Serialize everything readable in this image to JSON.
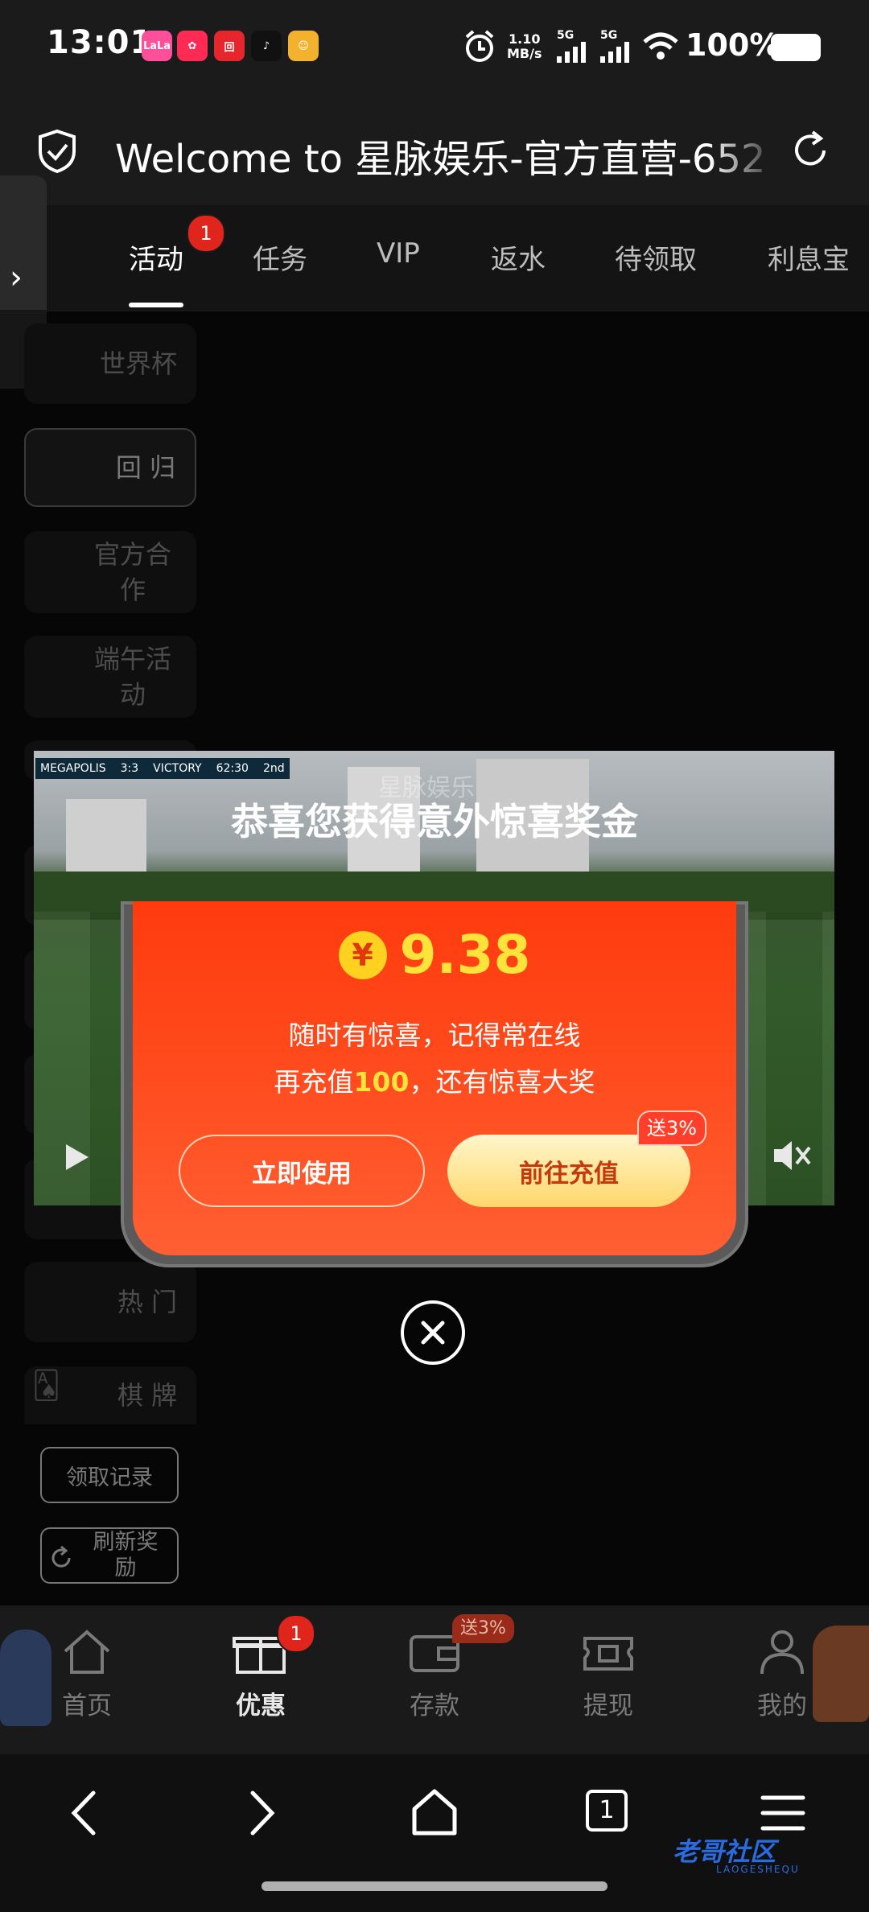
{
  "status_bar": {
    "time": "13:01",
    "app_icons": [
      {
        "name": "lala-app-icon",
        "label": "LaLa",
        "color": "#ff4f9a"
      },
      {
        "name": "xiaohongshu-app-icon",
        "label": "",
        "color": "#ff2b55"
      },
      {
        "name": "bank-app-icon",
        "label": "",
        "color": "#e5262c"
      },
      {
        "name": "tiktok-app-icon",
        "label": "",
        "color": "#111111"
      },
      {
        "name": "uc-app-icon",
        "label": "",
        "color": "#f3b22e"
      }
    ],
    "net_speed_value": "1.10",
    "net_speed_unit": "MB/s",
    "signal1": "5G",
    "signal2": "5G",
    "battery": "100%"
  },
  "browser": {
    "title": "Welcome to 星脉娱乐-官方直营-652"
  },
  "tabs": [
    {
      "label": "活动",
      "active": true,
      "badge": "1"
    },
    {
      "label": "任务"
    },
    {
      "label": "VIP"
    },
    {
      "label": "返水"
    },
    {
      "label": "待领取"
    },
    {
      "label": "利息宝"
    }
  ],
  "sidebar": {
    "items": [
      "世界杯",
      "回 归",
      "官方合作",
      "端午活动",
      "热 门",
      "棋 牌"
    ],
    "claim_record": "领取记录",
    "refresh_reward": "刷新奖励"
  },
  "video": {
    "team_left": "MEGAPOLIS",
    "score": "3:3",
    "team_right": "VICTORY",
    "clock": "62:30",
    "period": "2nd",
    "watermark": "星脉娱乐"
  },
  "popup": {
    "title": "恭喜您获得意外惊喜奖金",
    "currency_symbol": "¥",
    "amount": "9.38",
    "line1": "随时有惊喜，记得常在线",
    "line2_prefix": "再充值",
    "line2_highlight": "100",
    "line2_suffix": "，还有惊喜大奖",
    "use_button": "立即使用",
    "charge_button": "前往充值",
    "charge_bonus": "送3%"
  },
  "bottom_nav": {
    "items": [
      {
        "label": "首页"
      },
      {
        "label": "优惠",
        "active": true,
        "badge": "1"
      },
      {
        "label": "存款",
        "bonus": "送3%"
      },
      {
        "label": "提现"
      },
      {
        "label": "我的"
      }
    ]
  },
  "system_nav": {
    "tab_count": "1"
  },
  "watermark": {
    "text": "老哥社区",
    "sub": "LAOGESHEQU"
  }
}
